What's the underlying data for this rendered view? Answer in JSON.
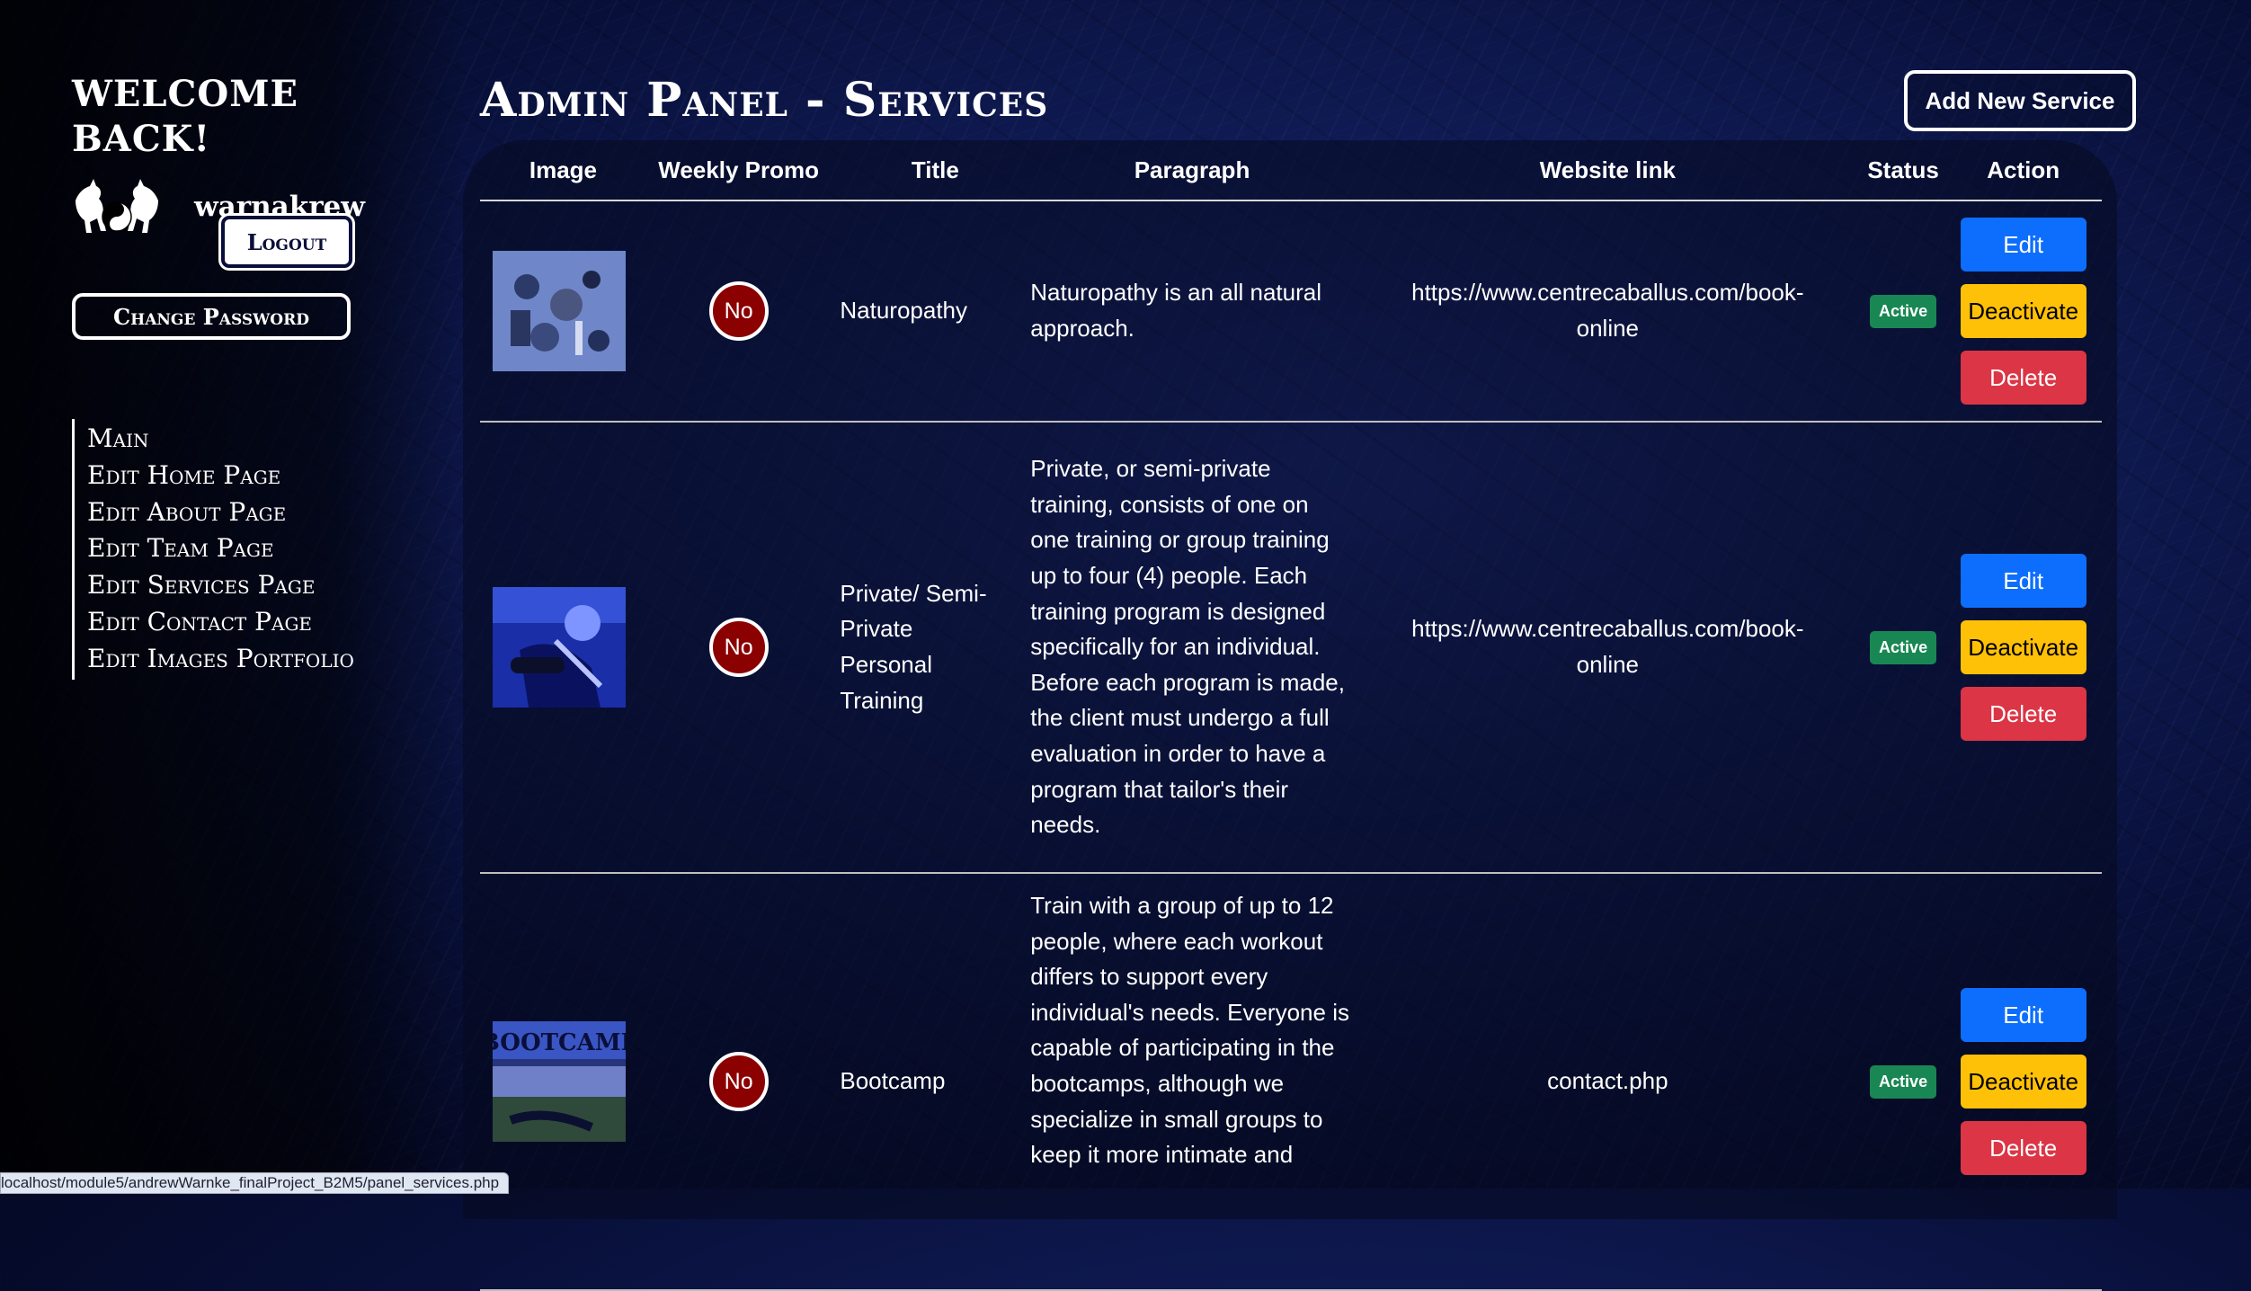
{
  "sidebar": {
    "welcome": "WELCOME BACK!",
    "username": "warnakrew",
    "logout_label": "Logout",
    "change_password_label": "Change Password",
    "nav": [
      "Main",
      "Edit Home Page",
      "Edit About Page",
      "Edit Team Page",
      "Edit Services Page",
      "Edit Contact Page",
      "Edit Images Portfolio"
    ]
  },
  "header": {
    "title": "Admin Panel - Services",
    "add_button": "Add New Service"
  },
  "table": {
    "columns": [
      "Image",
      "Weekly Promo",
      "Title",
      "Paragraph",
      "Website link",
      "Status",
      "Action"
    ],
    "rows": [
      {
        "promo": "No",
        "title": "Naturopathy",
        "paragraph": "Naturopathy is an all natural approach.",
        "link": "https://www.centrecaballus.com/book-online",
        "status": "Active",
        "actions": [
          "Edit",
          "Deactivate",
          "Delete"
        ]
      },
      {
        "promo": "No",
        "title": "Private/ Semi-Private Personal Training",
        "paragraph": "Private, or semi-private training, consists of one on one training or group training up to four (4) people. Each training program is designed specifically for an individual. Before each program is made, the client must undergo a full evaluation in order to have a program that tailor's their needs.",
        "link": "https://www.centrecaballus.com/book-online",
        "status": "Active",
        "actions": [
          "Edit",
          "Deactivate",
          "Delete"
        ]
      },
      {
        "promo": "No",
        "title": "Bootcamp",
        "paragraph": "Train with a group of up to 12 people, where each workout differs to support every individual's needs. Everyone is capable of participating in the bootcamps, although we specialize in small groups to keep it more intimate and",
        "link": "contact.php",
        "status": "Active",
        "actions": [
          "Edit",
          "Deactivate",
          "Delete"
        ]
      }
    ]
  },
  "thumb_texts": {
    "bootcamp": "BOOTCAMP"
  },
  "status_bar": "localhost/module5/andrewWarnke_finalProject_B2M5/panel_services.php",
  "colors": {
    "edit": "#0d6efd",
    "deactivate": "#ffc107",
    "delete": "#dc3545",
    "active": "#198754",
    "promo_no": "#8b0000"
  }
}
